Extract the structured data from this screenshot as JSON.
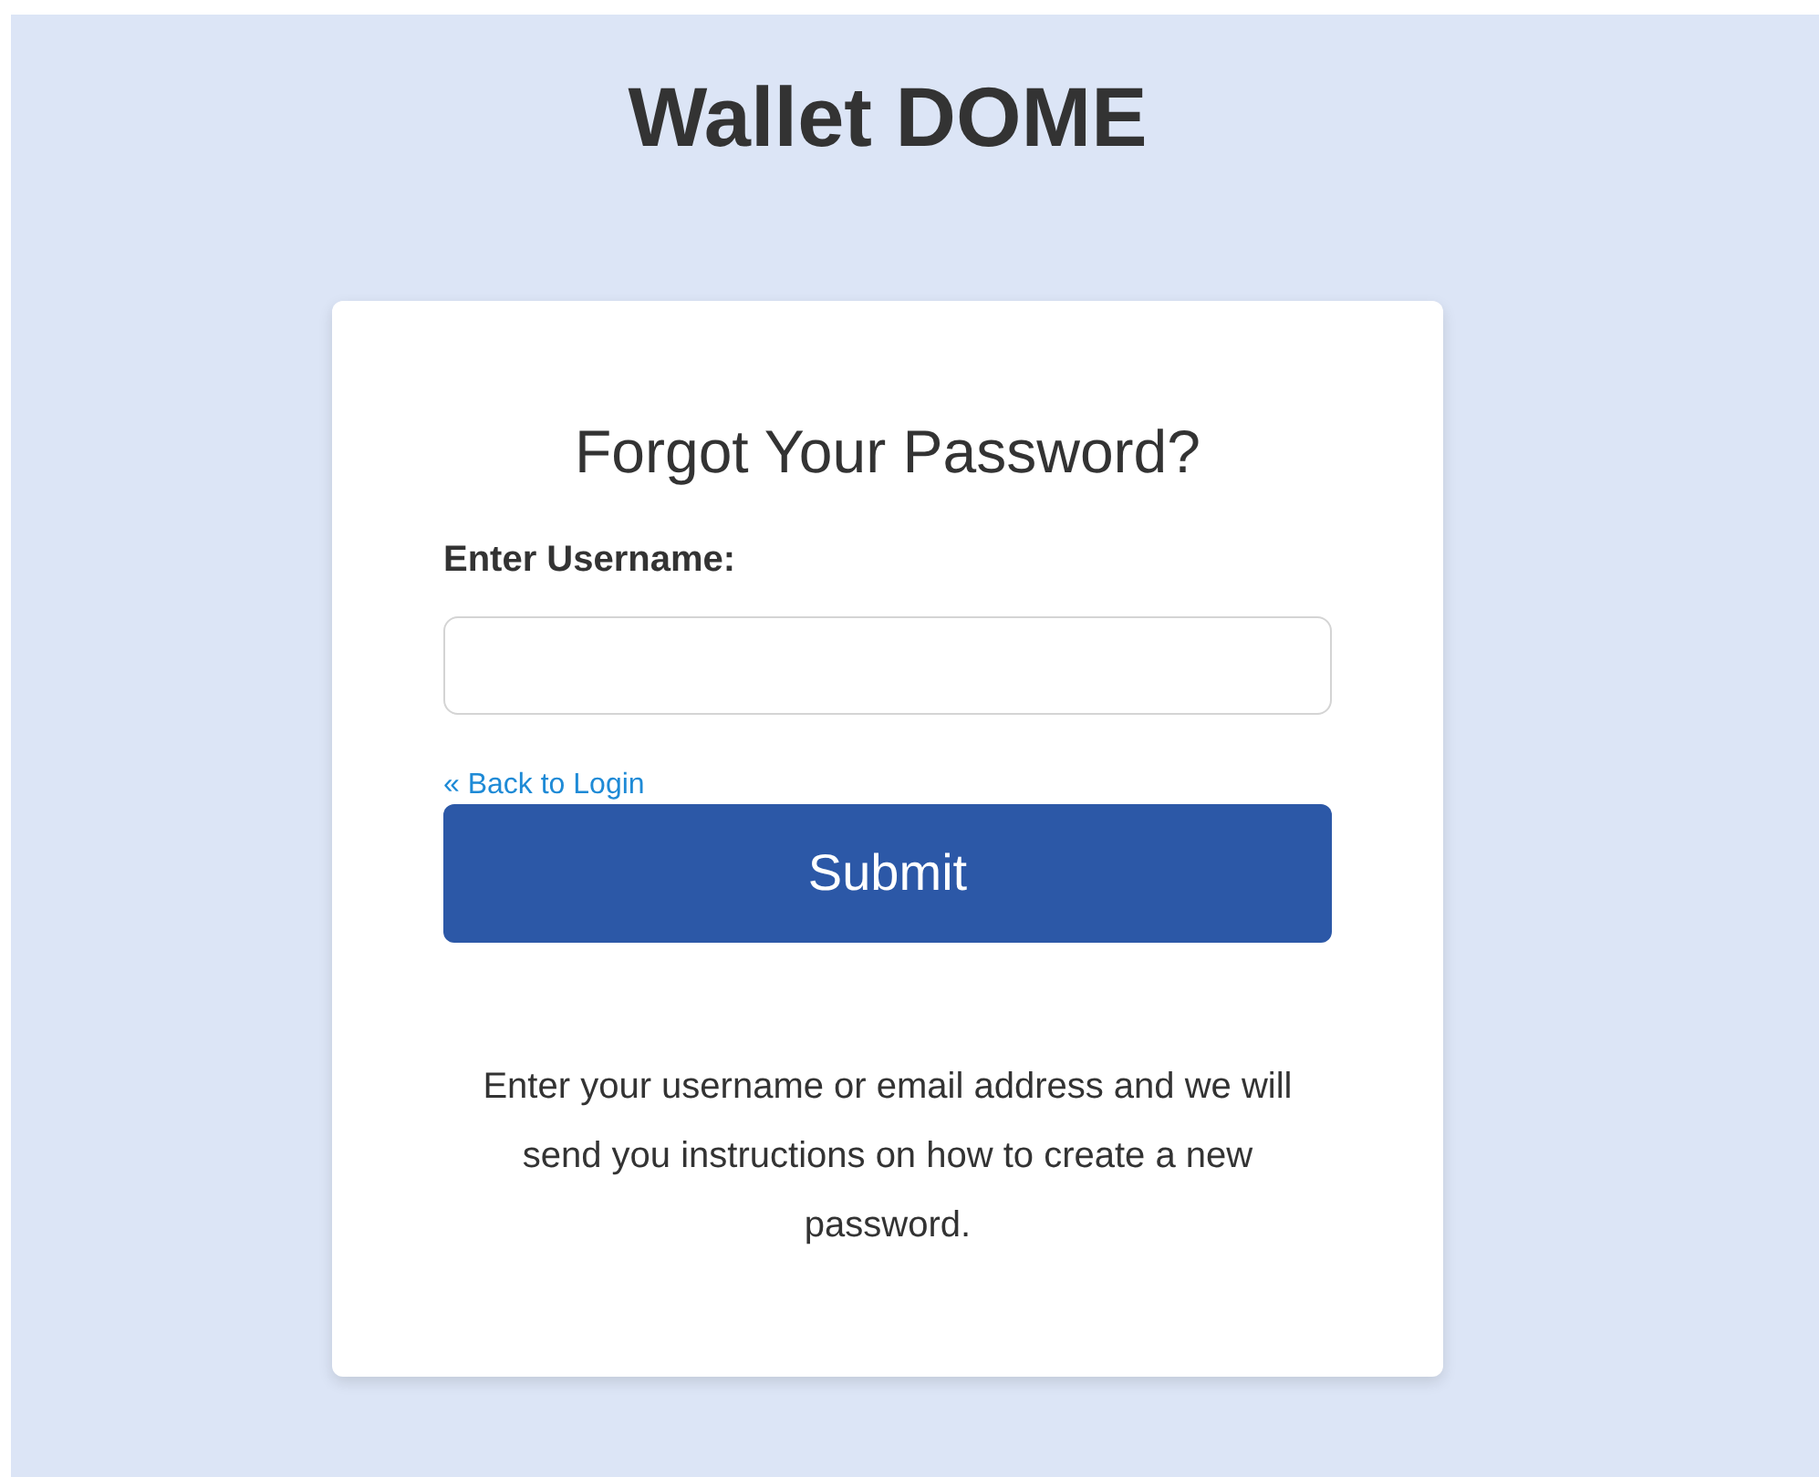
{
  "page": {
    "title": "Wallet DOME"
  },
  "form": {
    "heading": "Forgot Your Password?",
    "field_label": "Enter Username:",
    "back_link": "« Back to Login",
    "submit_button": "Submit",
    "help_text": "Enter your username or email address and we will send you instructions on how to create a new password."
  }
}
